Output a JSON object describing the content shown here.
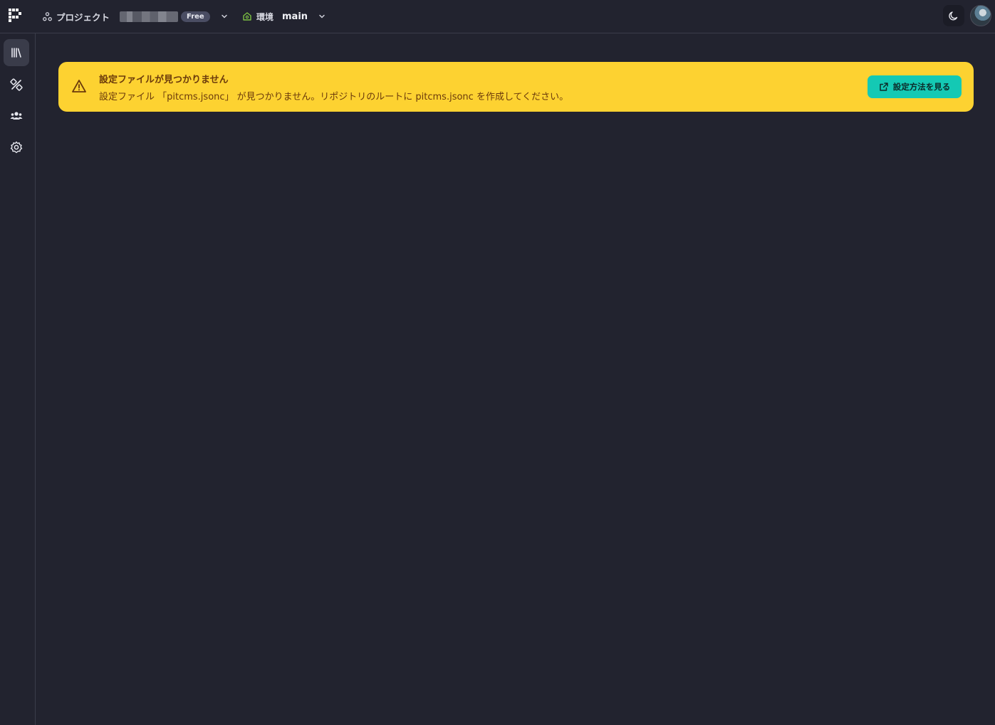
{
  "header": {
    "project_label": "プロジェクト",
    "plan_badge": "Free",
    "env_label": "環境",
    "branch": "main"
  },
  "sidebar": {
    "items": [
      {
        "icon": "library-icon",
        "active": true
      },
      {
        "icon": "design-tools-icon",
        "active": false
      },
      {
        "icon": "users-icon",
        "active": false
      },
      {
        "icon": "settings-icon",
        "active": false
      }
    ]
  },
  "alert": {
    "title": "設定ファイルが見つかりません",
    "message": "設定ファイル 「pitcms.jsonc」 が見つかりません。リポジトリのルートに pitcms.jsonc を作成してください。",
    "button_label": "設定方法を見る",
    "icon": "warning-icon",
    "colors": {
      "background": "#fdd231",
      "text": "#6b3a0b",
      "button": "#14c9b4"
    }
  },
  "colors": {
    "background": "#22232f",
    "border": "#3a3c4a"
  }
}
